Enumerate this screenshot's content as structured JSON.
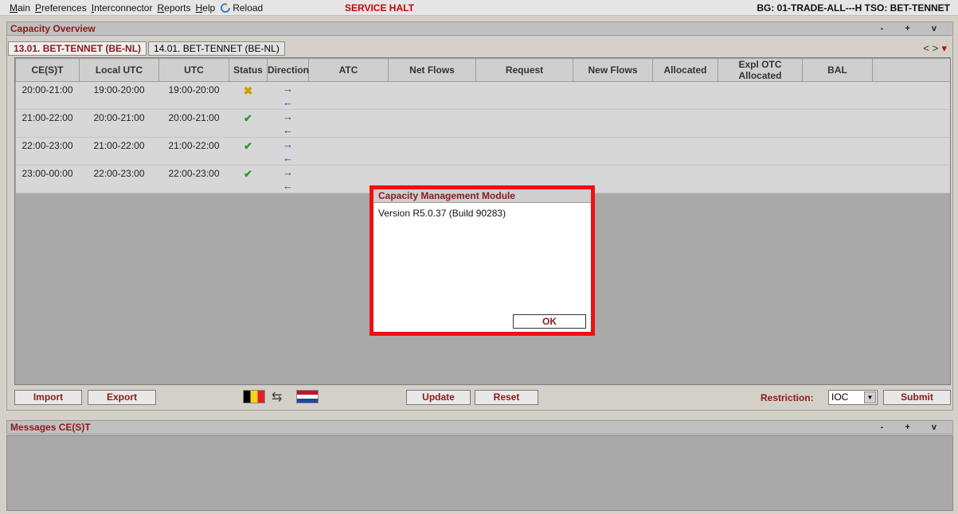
{
  "menu": {
    "items": [
      {
        "first": "M",
        "rest": "ain"
      },
      {
        "first": "P",
        "rest": "references"
      },
      {
        "first": "I",
        "rest": "nterconnector"
      },
      {
        "first": "R",
        "rest": "eports"
      },
      {
        "first": "H",
        "rest": "elp"
      }
    ],
    "reload_label": "Reload",
    "service_status": "SERVICE HALT",
    "bg_tso": "BG: 01-TRADE-ALL---H  TSO: BET-TENNET"
  },
  "capacity_panel": {
    "title": "Capacity Overview",
    "controls": "- + v",
    "tabs": [
      {
        "label": "13.01. BET-TENNET (BE-NL)",
        "active": true
      },
      {
        "label": "14.01. BET-TENNET (BE-NL)",
        "active": false
      }
    ],
    "nav_prev": "<",
    "nav_next": ">",
    "nav_menu": "▾"
  },
  "table": {
    "columns": [
      "CE(S)T",
      "Local UTC",
      "UTC",
      "Status",
      "Direction",
      "ATC",
      "Net Flows",
      "Request",
      "New Flows",
      "Allocated",
      "Expl OTC Allocated",
      "BAL"
    ],
    "rows": [
      {
        "cest": "20:00-21:00",
        "local_utc": "19:00-20:00",
        "utc": "19:00-20:00",
        "status": "halt",
        "status_icon": "x-icon",
        "dir_out": "→",
        "dir_in": "←"
      },
      {
        "cest": "21:00-22:00",
        "local_utc": "20:00-21:00",
        "utc": "20:00-21:00",
        "status": "ok",
        "status_icon": "check-icon",
        "dir_out": "→",
        "dir_in": "←"
      },
      {
        "cest": "22:00-23:00",
        "local_utc": "21:00-22:00",
        "utc": "21:00-22:00",
        "status": "ok",
        "status_icon": "check-icon",
        "dir_out": "→",
        "dir_in": "←"
      },
      {
        "cest": "23:00-00:00",
        "local_utc": "22:00-23:00",
        "utc": "22:00-23:00",
        "status": "ok",
        "status_icon": "check-icon",
        "dir_out": "→",
        "dir_in": "←"
      }
    ]
  },
  "buttons": {
    "import": "Import",
    "export": "Export",
    "update": "Update",
    "reset": "Reset",
    "submit": "Submit"
  },
  "restriction": {
    "label": "Restriction:",
    "value": "IOC"
  },
  "messages_panel": {
    "title": "Messages CE(S)T",
    "controls": "- + v"
  },
  "dialog": {
    "title": "Capacity Management Module",
    "version": "Version R5.0.37 (Build 90283)",
    "ok": "OK"
  },
  "colors": {
    "accent_title": "#8b1a1a",
    "service_halt": "#cc0000",
    "dialog_highlight": "#ee1111",
    "status_ok": "#2a9a2a",
    "status_halt": "#c7a000"
  }
}
